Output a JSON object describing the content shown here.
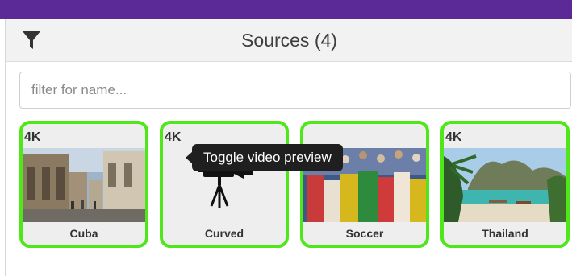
{
  "header": {
    "title": "Sources (4)"
  },
  "search": {
    "placeholder": "filter for name...",
    "value": ""
  },
  "sources": [
    {
      "badge": "4K",
      "name": "Cuba"
    },
    {
      "badge": "4K",
      "name": "Curved"
    },
    {
      "badge": "",
      "name": "Soccer"
    },
    {
      "badge": "4K",
      "name": "Thailand"
    }
  ],
  "tooltip": {
    "text": "Toggle video preview"
  },
  "icons": {
    "filter": "filter-icon",
    "camera": "video-camera-icon"
  },
  "colors": {
    "top_bar": "#5b2a96",
    "tile_border": "#4fe61a",
    "header_bg": "#f2f2f2",
    "tooltip_bg": "#1f1f1f"
  }
}
